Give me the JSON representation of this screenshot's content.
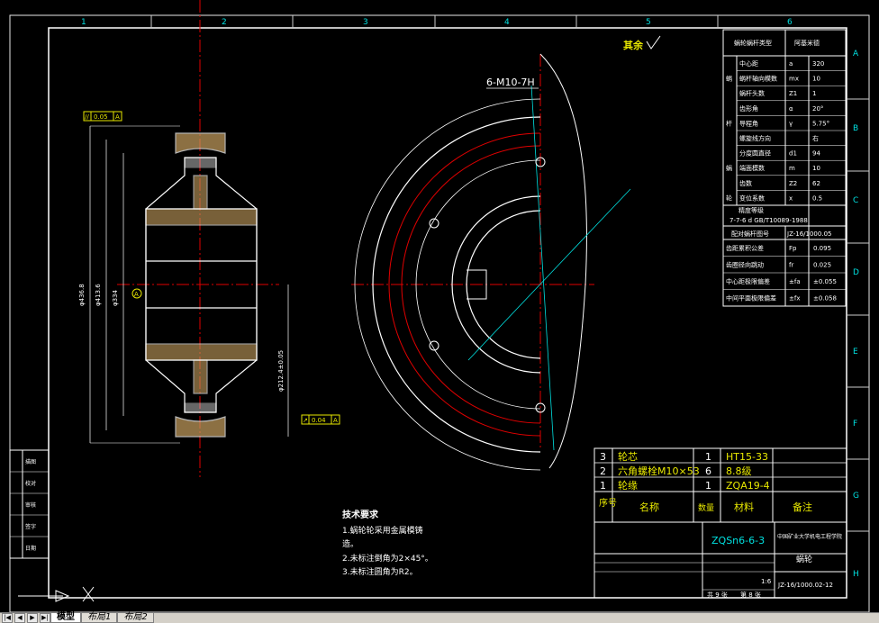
{
  "app": {
    "name": "AutoCAD drawing viewer"
  },
  "grid": {
    "columns": [
      "1",
      "2",
      "3",
      "4",
      "5",
      "6"
    ],
    "rows": [
      "A",
      "B",
      "C",
      "D",
      "E",
      "F",
      "G",
      "H"
    ]
  },
  "header": {
    "surface_finish_label": "其余",
    "hole_callout": "6-M10-7H"
  },
  "left_view": {
    "gdt_top": {
      "symbol": "//",
      "value": "0.05",
      "datum": "A"
    },
    "gdt_bottom": {
      "symbol": "↗",
      "value": "0.04",
      "datum": "A"
    },
    "datum_label": "A",
    "dims": [
      "φ436.8",
      "φ413.6",
      "φ334",
      "φ212.4±0.05"
    ]
  },
  "tech_req": {
    "title": "技术要求",
    "items": [
      "1.蜗轮轮采用金属模铸",
      "造。",
      "2.未标注倒角为2×45°。",
      "3.未标注圆角为R2。"
    ]
  },
  "param_table": {
    "header": [
      "蜗轮蜗杆类型",
      "阿基米德"
    ],
    "rows": [
      [
        "",
        "中心距",
        "a",
        "320"
      ],
      [
        "蜗",
        "蜗杆轴向模数",
        "mx",
        "10"
      ],
      [
        "",
        "蜗杆头数",
        "Z1",
        "1"
      ],
      [
        "",
        "齿形角",
        "α",
        "20°"
      ],
      [
        "杆",
        "导程角",
        "γ",
        "5.75°"
      ],
      [
        "",
        "螺旋线方向",
        "",
        "右"
      ],
      [
        "",
        "分度圆直径",
        "d1",
        "94"
      ],
      [
        "蜗",
        "端面模数",
        "m",
        "10"
      ],
      [
        "",
        "齿数",
        "Z2",
        "62"
      ],
      [
        "轮",
        "变位系数",
        "x",
        "0.5"
      ]
    ],
    "precision_title": "精度等级",
    "precision_value": "7-7-6 d GB/T10089-1988",
    "drawing_ref": [
      "配对蜗杆图号",
      "JZ-16/1000.05"
    ],
    "tolerance_rows": [
      [
        "齿距累积公差",
        "Fp",
        "0.095"
      ],
      [
        "齿圈径向跳动",
        "fr",
        "0.025"
      ],
      [
        "中心距极限偏差",
        "±fa",
        "±0.055"
      ],
      [
        "中间平面极限偏差",
        "±fx",
        "±0.058"
      ]
    ]
  },
  "bom": {
    "rows": [
      [
        "3",
        "轮芯",
        "1",
        "HT15-33",
        ""
      ],
      [
        "2",
        "六角螺栓M10×53",
        "6",
        "8.8级",
        ""
      ],
      [
        "1",
        "轮缘",
        "1",
        "ZQA19-4",
        ""
      ]
    ],
    "header": [
      "序号",
      "名称",
      "数量",
      "材料",
      "备注"
    ]
  },
  "title_block": {
    "material": "ZQSn6-6-3",
    "organization": "中国矿业大学机电工程学院",
    "part_name": "蜗轮",
    "drawing_no": "JZ-16/1000.02-12",
    "scale": "1:6",
    "sheet_total": "共 9 张",
    "sheet_no": "第 8 张"
  },
  "left_strip": [
    "描图",
    "校对",
    "审核",
    "签字",
    "日期"
  ],
  "tabs": [
    "模型",
    "布局1",
    "布局2"
  ]
}
